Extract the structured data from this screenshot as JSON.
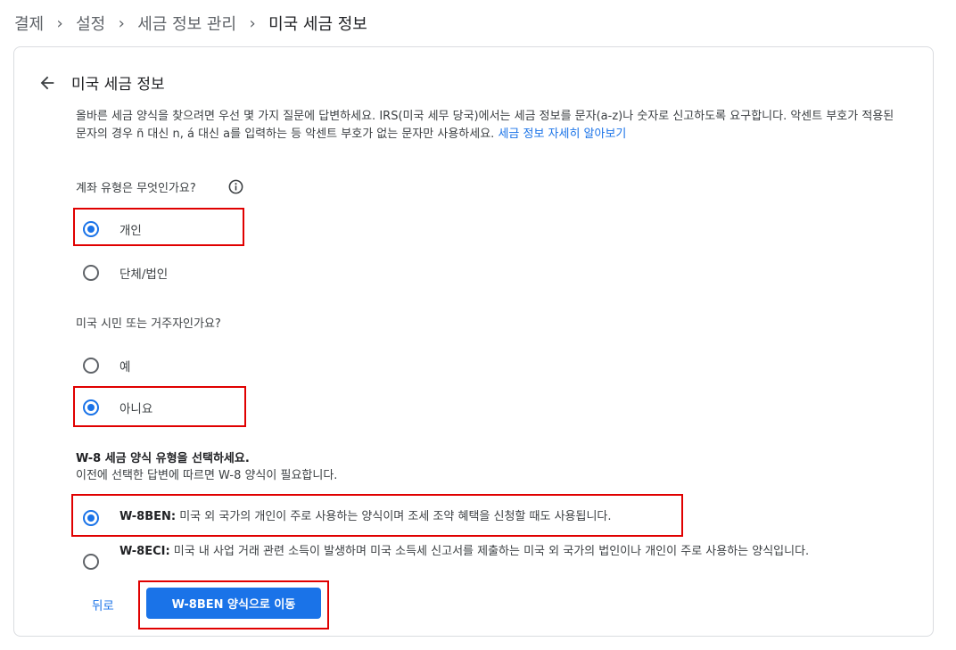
{
  "breadcrumb": {
    "items": [
      "결제",
      "설정",
      "세금 정보 관리",
      "미국 세금 정보"
    ],
    "separator": "›"
  },
  "header": {
    "back_icon": "arrow-back-icon",
    "title": "미국 세금 정보"
  },
  "intro": {
    "text": "올바른 세금 양식을 찾으려면 우선 몇 가지 질문에 답변하세요. IRS(미국 세무 당국)에서는 세금 정보를 문자(a-z)나 숫자로 신고하도록 요구합니다. 악센트 부호가 적용된 문자의 경우 ñ 대신 n, á 대신 a를 입력하는 등 악센트 부호가 없는 문자만 사용하세요.",
    "link": "세금 정보 자세히 알아보기"
  },
  "account_type": {
    "question": "계좌 유형은 무엇인가요?",
    "info_icon": "info-icon",
    "options": [
      "개인",
      "단체/법인"
    ],
    "selected": "개인"
  },
  "us_citizen": {
    "question": "미국 시민 또는 거주자인가요?",
    "options": [
      "예",
      "아니요"
    ],
    "selected": "아니요"
  },
  "w8": {
    "title": "W-8 세금 양식 유형을 선택하세요.",
    "subtitle": "이전에 선택한 답변에 따르면 W-8 양식이 필요합니다.",
    "options": [
      {
        "code": "W-8BEN:",
        "desc": "미국 외 국가의 개인이 주로 사용하는 양식이며 조세 조약 혜택을 신청할 때도 사용됩니다."
      },
      {
        "code": "W-8ECI:",
        "desc": "미국 내 사업 거래 관련 소득이 발생하며 미국 소득세 신고서를 제출하는 미국 외 국가의 법인이나 개인이 주로 사용하는 양식입니다."
      }
    ],
    "selected": "W-8BEN:"
  },
  "actions": {
    "back": "뒤로",
    "primary": "W-8BEN 양식으로 이동"
  },
  "colors": {
    "accent": "#1a73e8",
    "highlight": "#e00000"
  }
}
